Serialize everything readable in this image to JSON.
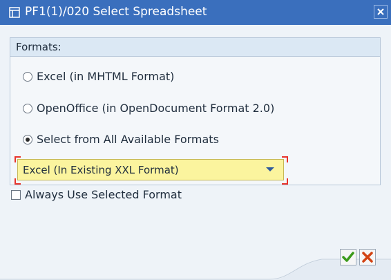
{
  "dialog": {
    "title": "PF1(1)/020 Select Spreadsheet"
  },
  "formats_group": {
    "label": "Formats:",
    "options": [
      {
        "label": "Excel (in MHTML Format)",
        "selected": false
      },
      {
        "label": "OpenOffice (in OpenDocument Format 2.0)",
        "selected": false
      },
      {
        "label": "Select from All Available Formats",
        "selected": true
      }
    ],
    "format_select": {
      "value": "Excel (In Existing XXL Format)"
    }
  },
  "always_use": {
    "label": "Always Use Selected Format",
    "checked": false
  },
  "colors": {
    "title_bar": "#3a6fbd",
    "dropdown_background": "#fbf49e",
    "required_marker": "#e8332b",
    "confirm_green": "#3b9a1a",
    "cancel_red": "#d24313"
  },
  "icons": {
    "title": "dialog-window-icon",
    "close": "close-icon",
    "dropdown": "dropdown-arrow-icon",
    "confirm": "checkmark-icon",
    "cancel": "cancel-x-icon"
  }
}
